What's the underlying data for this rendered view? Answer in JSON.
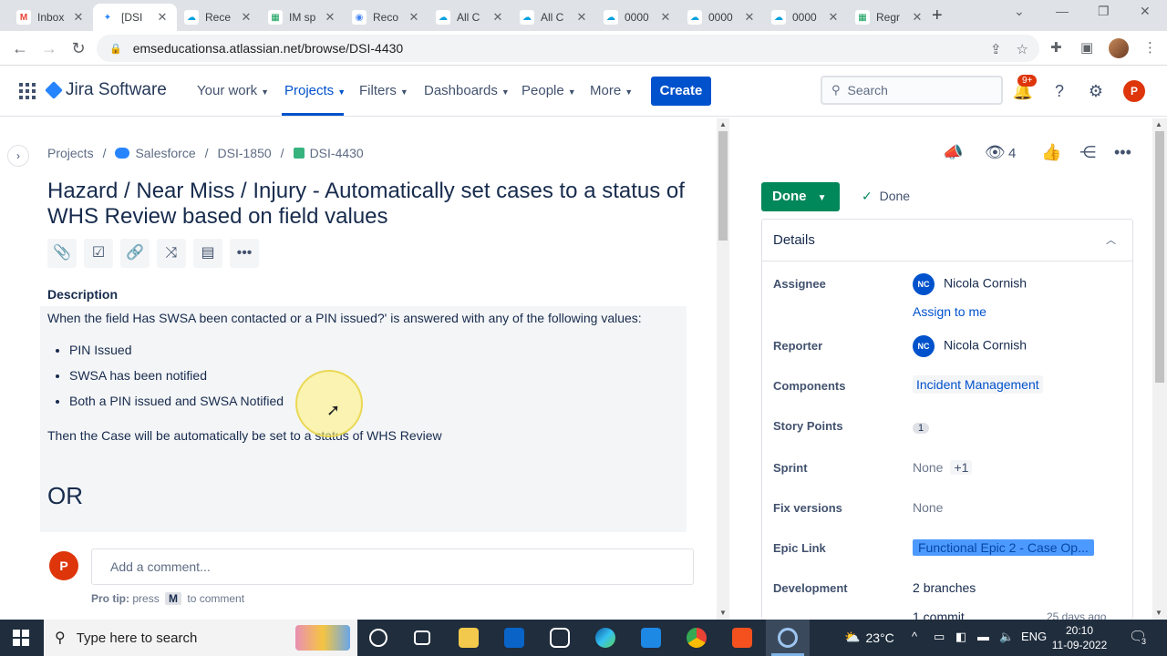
{
  "browser": {
    "tabs": [
      {
        "title": "Inbox",
        "icon": "gmail-icon",
        "color": "#ea4335",
        "glyph": "M"
      },
      {
        "title": "[DSI",
        "icon": "jira-icon",
        "color": "#2684ff",
        "glyph": "✦"
      },
      {
        "title": "Rece",
        "icon": "salesforce-icon",
        "color": "#00a1e0",
        "glyph": "☁"
      },
      {
        "title": "IM sp",
        "icon": "sheets-icon",
        "color": "#0f9d58",
        "glyph": "▦"
      },
      {
        "title": "Reco",
        "icon": "record-icon",
        "color": "#4285f4",
        "glyph": "◉"
      },
      {
        "title": "All C",
        "icon": "salesforce-icon",
        "color": "#00a1e0",
        "glyph": "☁"
      },
      {
        "title": "All C",
        "icon": "salesforce-icon",
        "color": "#00a1e0",
        "glyph": "☁"
      },
      {
        "title": "0000",
        "icon": "salesforce-icon",
        "color": "#00a1e0",
        "glyph": "☁"
      },
      {
        "title": "0000",
        "icon": "salesforce-icon",
        "color": "#00a1e0",
        "glyph": "☁"
      },
      {
        "title": "0000",
        "icon": "salesforce-icon",
        "color": "#00a1e0",
        "glyph": "☁"
      },
      {
        "title": "Regr",
        "icon": "sheets-icon",
        "color": "#0f9d58",
        "glyph": "▦"
      }
    ],
    "url": "emseducationsa.atlassian.net/browse/DSI-4430"
  },
  "jira_nav": {
    "product": "Jira Software",
    "items": [
      {
        "label": "Your work",
        "active": false
      },
      {
        "label": "Projects",
        "active": true
      },
      {
        "label": "Filters",
        "active": false
      },
      {
        "label": "Dashboards",
        "active": false
      },
      {
        "label": "People",
        "active": false
      },
      {
        "label": "More",
        "active": false
      }
    ],
    "create_label": "Create",
    "search_placeholder": "Search",
    "notification_badge": "9+",
    "profile_initial": "P"
  },
  "issue": {
    "breadcrumb": {
      "projects": "Projects",
      "project": "Salesforce",
      "epic": "DSI-1850",
      "key": "DSI-4430"
    },
    "title": "Hazard / Near Miss / Injury - Automatically set cases to a status of WHS Review based on field values",
    "description_label": "Description",
    "description": {
      "intro": "When the field Has SWSA been contacted or a PIN issued?' is answered with any of the following values:",
      "bullets": [
        "PIN Issued",
        "SWSA has been notified",
        "Both a PIN issued and SWSA Notified"
      ],
      "outcome": "Then the Case will be automatically be set to a status of WHS Review",
      "or_heading": "OR"
    },
    "comment": {
      "avatar_initial": "P",
      "placeholder": "Add a comment...",
      "protip_label": "Pro tip:",
      "protip_press": "press",
      "protip_key": "M",
      "protip_suffix": "to comment"
    }
  },
  "sidebar": {
    "watch_count": "4",
    "status_label": "Done",
    "resolution": "Done",
    "details_title": "Details",
    "fields": {
      "assignee_label": "Assignee",
      "assignee_initials": "NC",
      "assignee_name": "Nicola Cornish",
      "assign_to_me": "Assign to me",
      "reporter_label": "Reporter",
      "reporter_initials": "NC",
      "reporter_name": "Nicola Cornish",
      "components_label": "Components",
      "components_value": "Incident Management",
      "story_points_label": "Story Points",
      "story_points_value": "1",
      "sprint_label": "Sprint",
      "sprint_value": "None",
      "sprint_more": "+1",
      "fix_versions_label": "Fix versions",
      "fix_versions_value": "None",
      "epic_link_label": "Epic Link",
      "epic_link_value": "Functional Epic 2 - Case Op...",
      "development_label": "Development",
      "branches_count": "2",
      "branches_label": "branches",
      "commit_text": "1 commit",
      "commit_ago": "25 days ago"
    }
  },
  "taskbar": {
    "search_placeholder": "Type here to search",
    "weather_temp": "23°C",
    "language": "ENG",
    "time": "20:10",
    "date": "11-09-2022",
    "notification_count": "3"
  },
  "colors": {
    "jira_blue": "#0052cc",
    "done_green": "#00875a",
    "epic_blue": "#4c9aff"
  }
}
